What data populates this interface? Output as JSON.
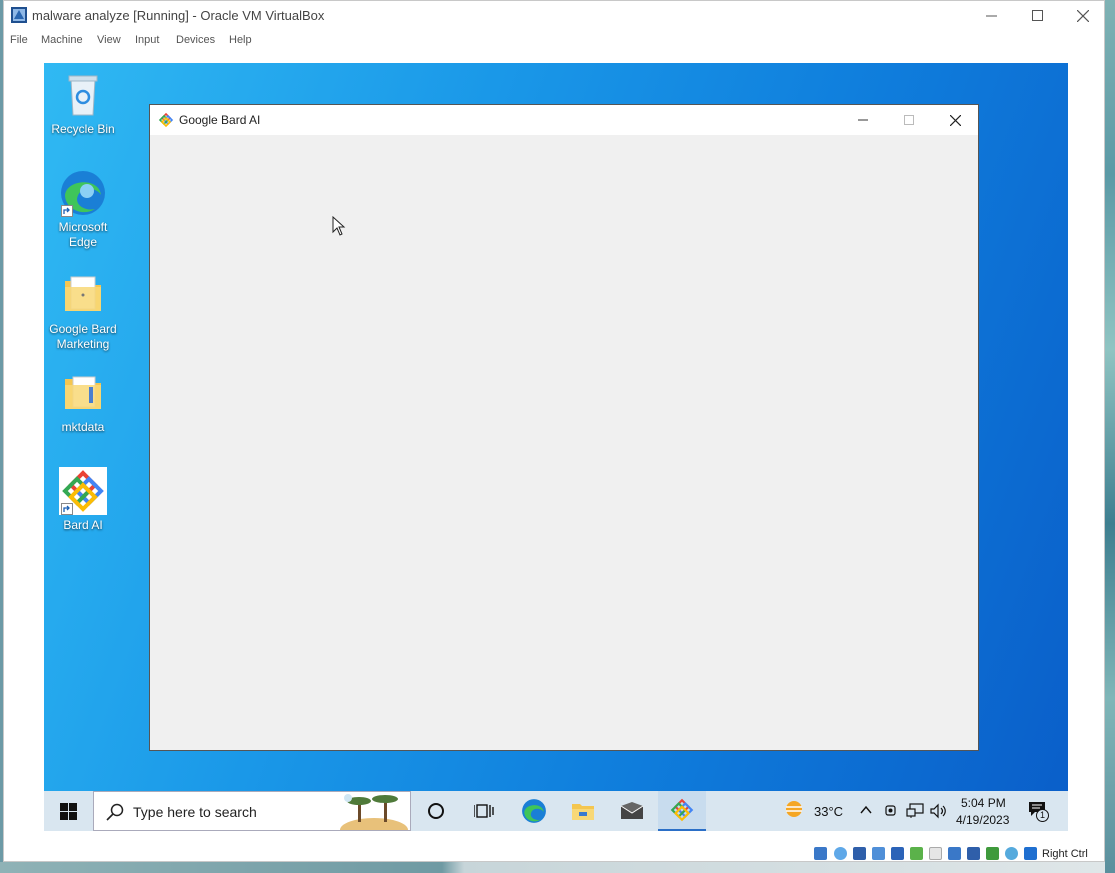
{
  "vbox": {
    "title": "malware analyze [Running] - Oracle VM VirtualBox",
    "menu": [
      "File",
      "Machine",
      "View",
      "Input",
      "Devices",
      "Help"
    ],
    "status_host_key": "Right Ctrl"
  },
  "desktop": {
    "icons": [
      {
        "label": "Recycle Bin",
        "icon": "recycle-bin-icon"
      },
      {
        "label": "Microsoft Edge",
        "icon": "edge-icon"
      },
      {
        "label": "Google Bard Marketing",
        "icon": "folder-icon"
      },
      {
        "label": "mktdata",
        "icon": "folder-icon"
      },
      {
        "label": "Bard AI",
        "icon": "bard-logo-icon"
      }
    ]
  },
  "bard_window": {
    "title": "Google Bard AI"
  },
  "taskbar": {
    "search_placeholder": "Type here to search",
    "weather": "33°C",
    "time": "5:04 PM",
    "date": "4/19/2023",
    "notification_count": "1"
  },
  "colors": {
    "desktop_accent": "#0f7ddc",
    "taskbar": "#d9e6f0"
  }
}
